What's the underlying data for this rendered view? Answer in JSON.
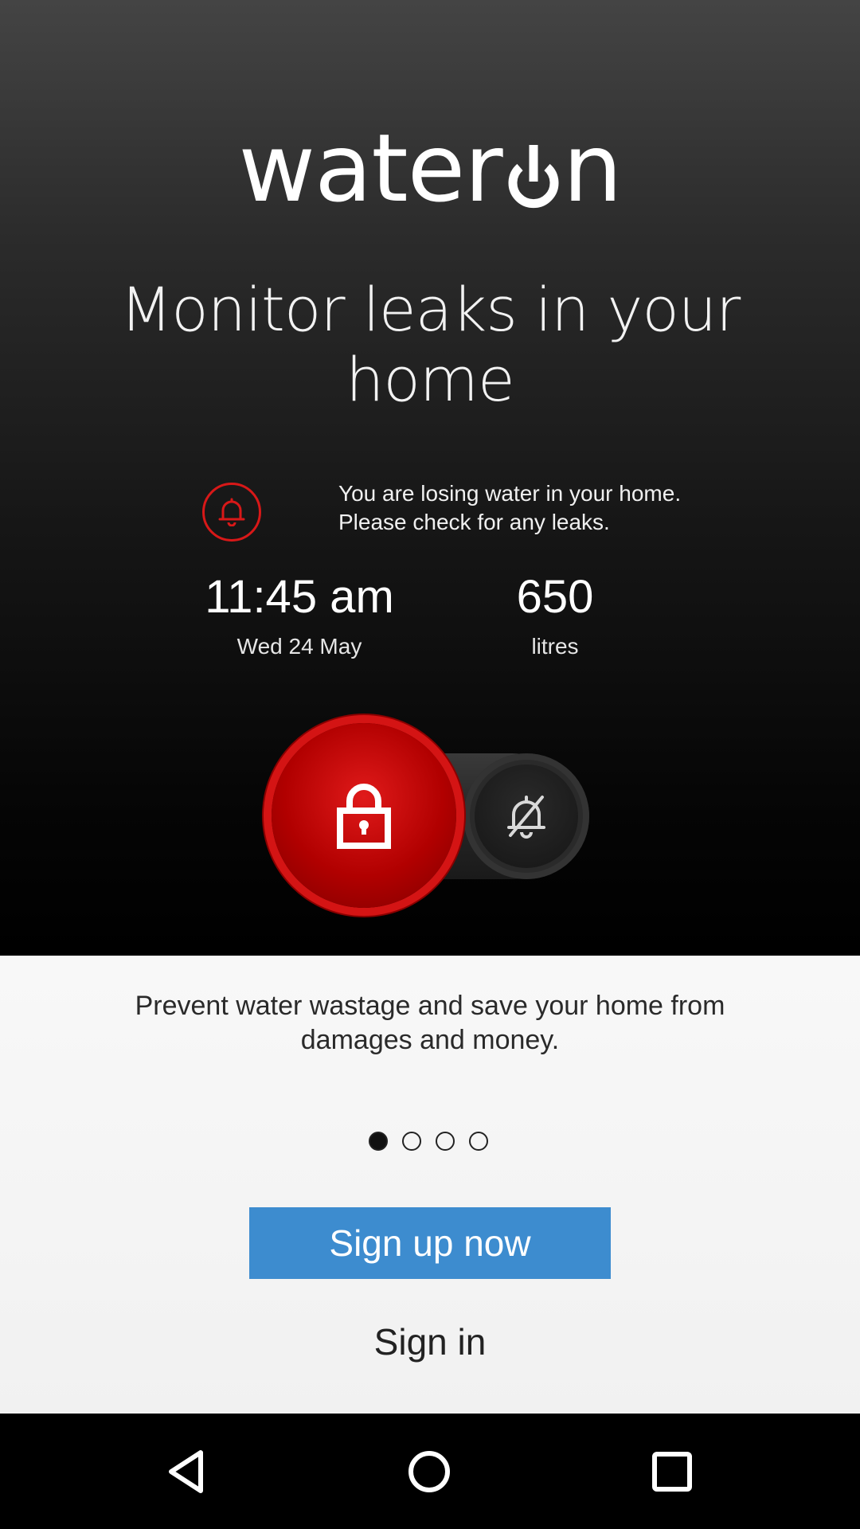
{
  "app": {
    "logo_text_before": "water",
    "logo_text_after": "n",
    "brand_colors": {
      "accent_red": "#d41414",
      "button_blue": "#3d8ccf"
    }
  },
  "hero": {
    "headline": "Monitor leaks in your home",
    "alert_icon": "bell-icon",
    "alert_message": "You are losing water in your home. Please check for any leaks.",
    "time_value": "11:45 am",
    "date_value": "Wed 24 May",
    "volume_value": "650",
    "volume_unit": "litres",
    "slider": {
      "lock_icon": "lock-icon",
      "mute_icon": "bell-off-icon"
    }
  },
  "panel": {
    "description": "Prevent water wastage and save your home from damages and money.",
    "pager": {
      "total": 4,
      "active_index": 0
    },
    "signup_label": "Sign up now",
    "signin_label": "Sign in"
  },
  "navbar": {
    "back_icon": "back-triangle-icon",
    "home_icon": "home-circle-icon",
    "recent_icon": "recent-apps-square-icon"
  }
}
